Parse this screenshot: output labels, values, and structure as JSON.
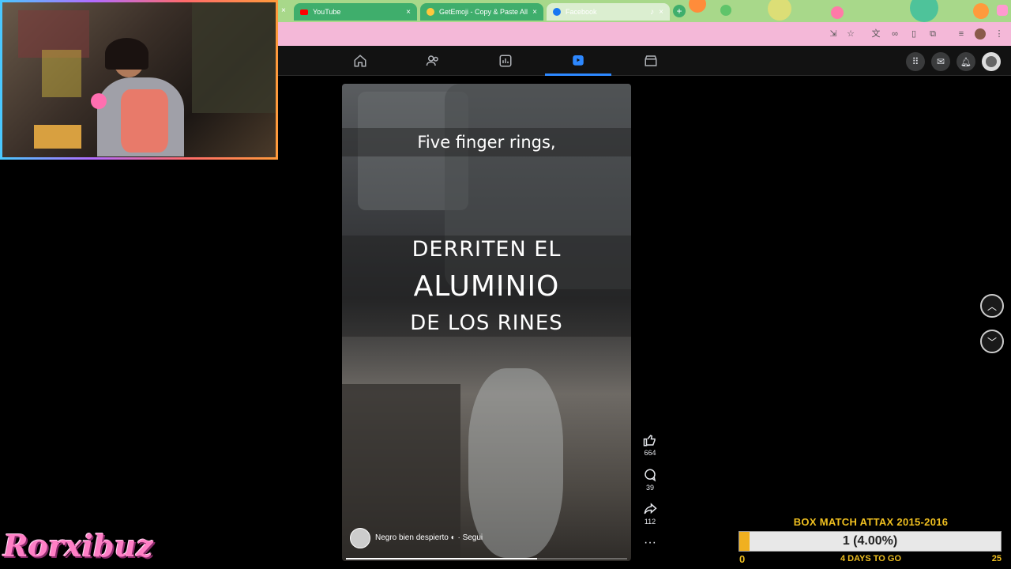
{
  "browser": {
    "tabs": [
      {
        "label": "YouTube",
        "color": "#3fae6c",
        "icon": "youtube-icon"
      },
      {
        "label": "GetEmoji - Copy & Paste All E",
        "color": "#3fae6c",
        "icon": "emoji-icon"
      },
      {
        "label": "Facebook",
        "color": "#3fae6c",
        "icon": "facebook-icon"
      }
    ],
    "new_tab": "+"
  },
  "facebook": {
    "nav": [
      "home-icon",
      "friends-icon",
      "dashboard-icon",
      "reels-icon",
      "marketplace-icon"
    ],
    "active_nav": "reels-icon",
    "accent": "#2d88ff"
  },
  "reel": {
    "caption_top": "Five finger rings,",
    "caption_line1": "DERRITEN EL",
    "caption_line2": "ALUMINIO",
    "caption_line3": "DE LOS RINES",
    "author": "Negro bien despierto",
    "follow": "Segui",
    "likes": "664",
    "comments": "39",
    "shares": "112",
    "progress": 0.68
  },
  "goal_widget": {
    "title": "BOX MATCH ATTAX 2015-2016",
    "value_label": "1 (4.00%)",
    "min": "0",
    "max": "25",
    "remaining": "4 DAYS TO GO",
    "progress": 0.04,
    "title_color": "#f0c020"
  },
  "stream_brand": "Rorxibuz"
}
